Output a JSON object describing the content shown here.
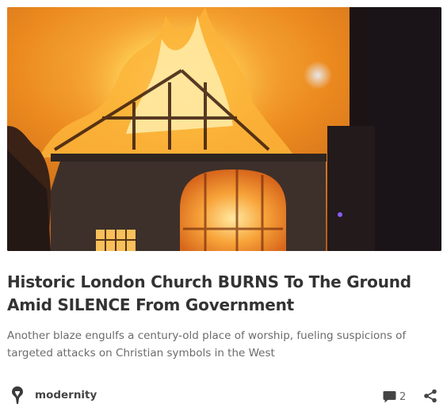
{
  "article": {
    "title": "Historic London Church BURNS To The Ground Amid SILENCE From Government",
    "subtitle": "Another blaze engulfs a century-old place of worship, fueling suspicions of targeted attacks on Christian symbols in the West",
    "image_alt": "Church building engulfed in flames at night"
  },
  "author": {
    "name": "modernity",
    "avatar_icon": "avatar-icon"
  },
  "engagement": {
    "comment_count": "2",
    "comment_icon": "comment-bubble-icon",
    "share_icon": "share-icon"
  },
  "colors": {
    "title": "#333333",
    "subtitle": "#6b6b6b",
    "author": "#444444",
    "fire": "#f59a1f",
    "sky": "#e5851c"
  }
}
